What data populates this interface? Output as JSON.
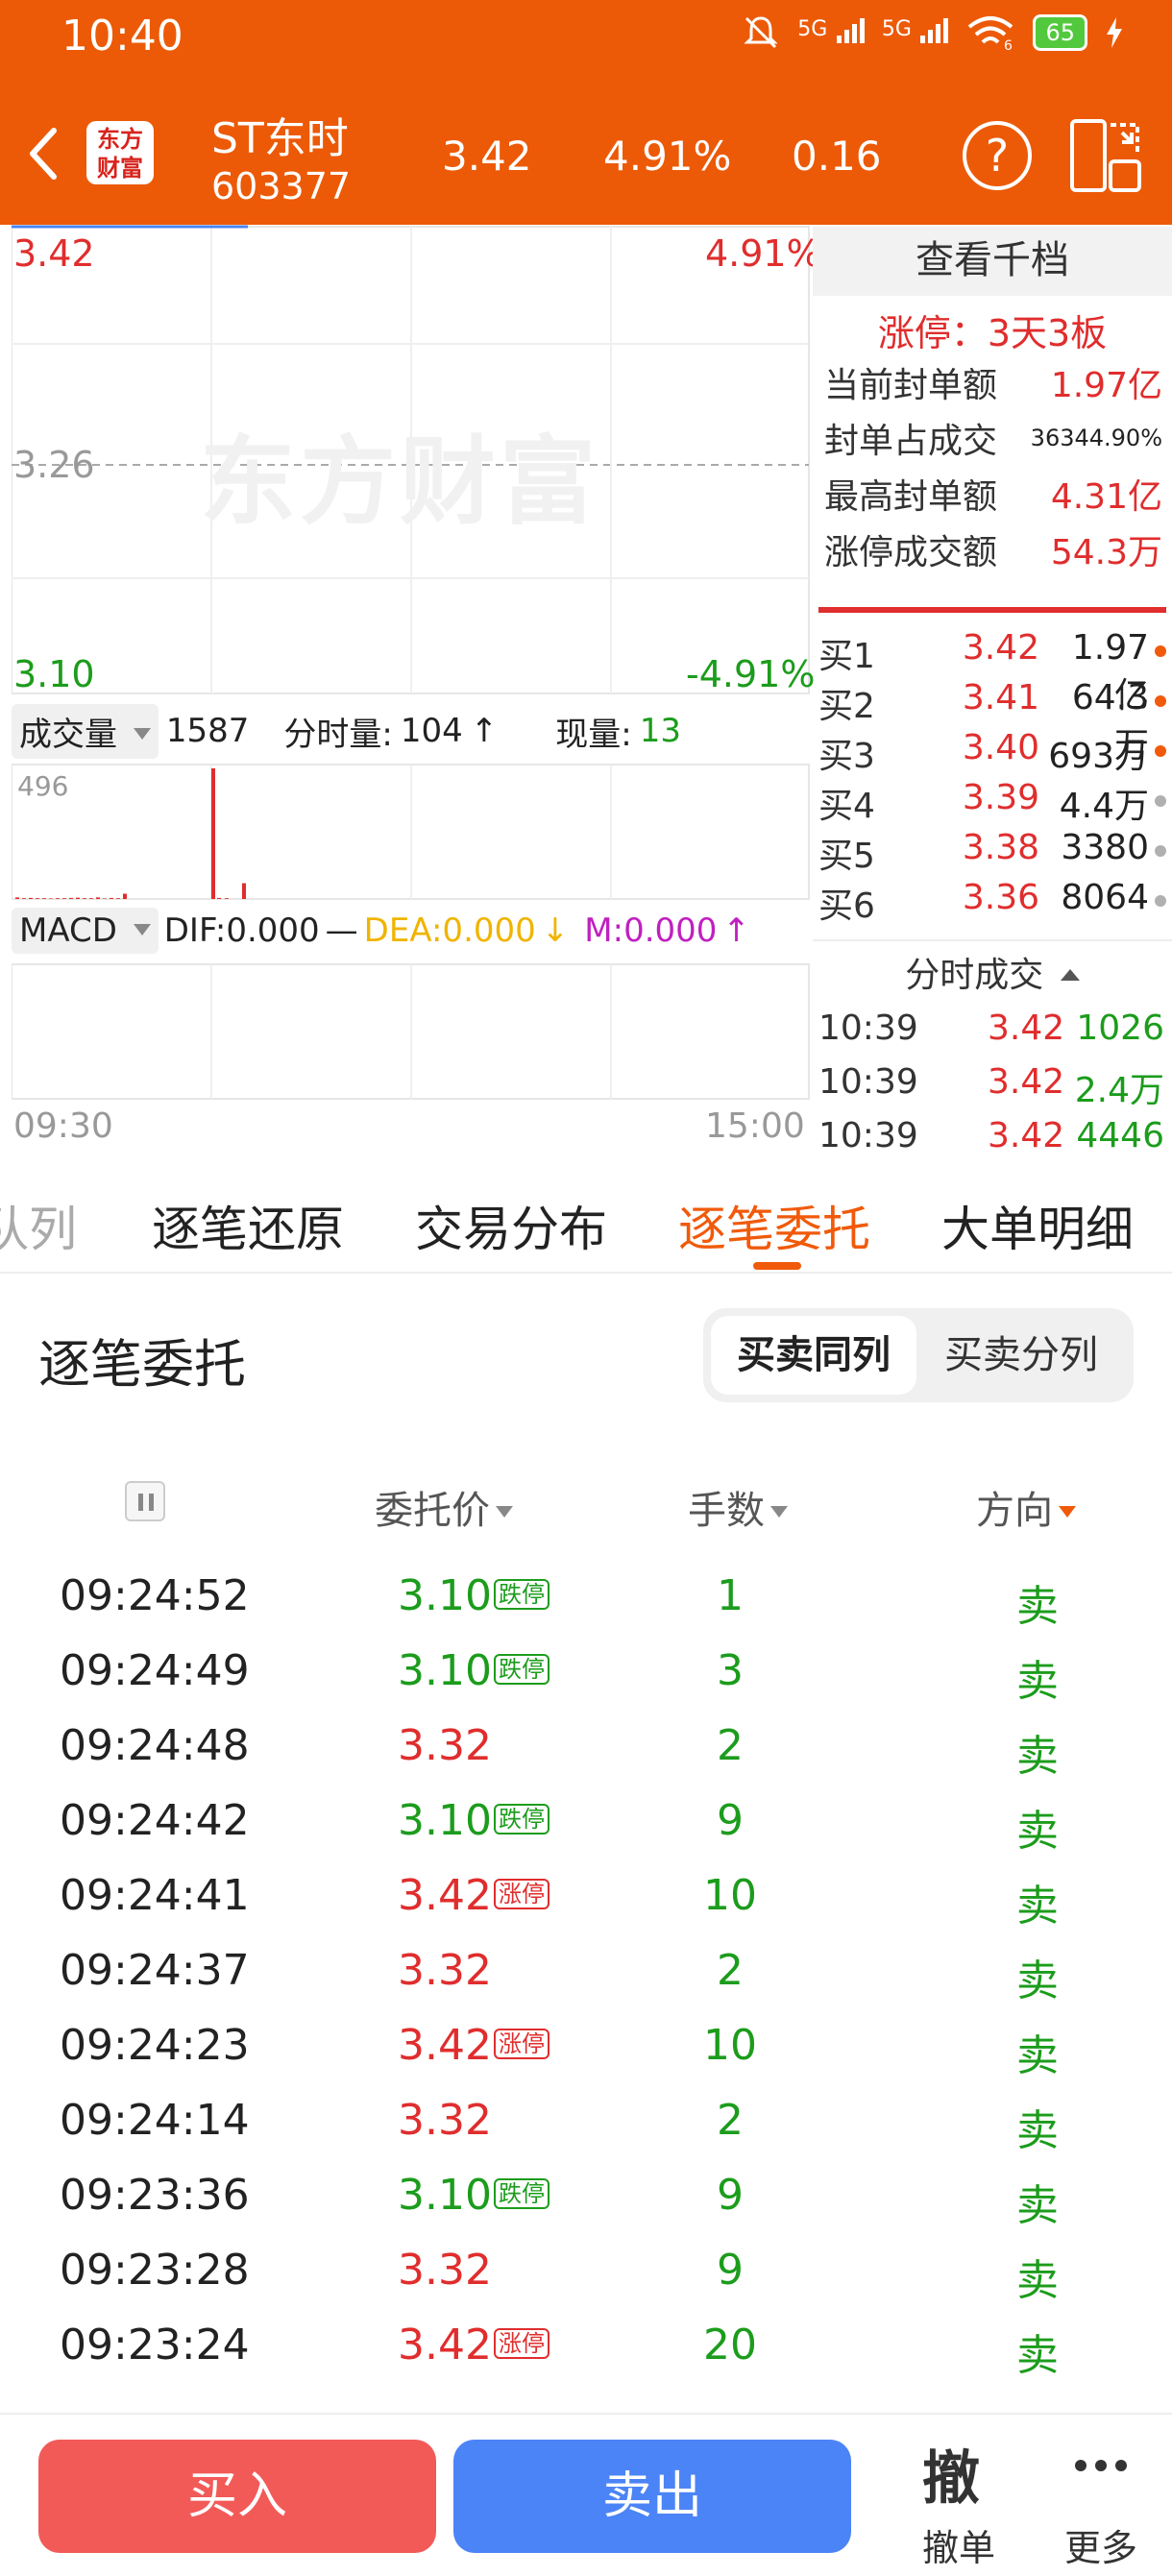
{
  "status": {
    "time": "10:40",
    "sig1": "5G",
    "sig2": "5G",
    "wifi_mark": "6",
    "battery": "65"
  },
  "header": {
    "logo_line1": "东方",
    "logo_line2": "财富",
    "name": "ST东时",
    "code": "603377",
    "price": "3.42",
    "pct": "4.91%",
    "change": "0.16"
  },
  "chart": {
    "top_left": "3.42",
    "top_right": "4.91%",
    "mid": "3.26",
    "bottom_left": "3.10",
    "bottom_right": "-4.91%",
    "watermark": "东方财富",
    "volume_select": "成交量",
    "volume_value": "1587",
    "minute_vol_label": "分时量:",
    "minute_vol_value": "104",
    "current_vol_label": "现量:",
    "current_vol_value": "13",
    "vol_axis_max": "496",
    "macd_select": "MACD",
    "dif": "DIF:0.000",
    "dea": "DEA:0.000",
    "m": "M:0.000",
    "time_start": "09:30",
    "time_end": "15:00",
    "volume_bars": [
      6,
      3,
      4,
      3,
      3,
      2,
      3,
      3,
      4,
      5,
      3,
      3,
      6,
      2,
      4,
      3,
      20,
      496,
      4,
      3,
      60
    ]
  },
  "right_panel": {
    "qiandang": "查看千档",
    "limit_title": "涨停：3天3板",
    "seal_rows": [
      {
        "label": "当前封单额",
        "value": "1.97亿"
      },
      {
        "label": "封单占成交",
        "value": "36344.90%"
      },
      {
        "label": "最高封单额",
        "value": "4.31亿"
      },
      {
        "label": "涨停成交额",
        "value": "54.3万"
      }
    ],
    "book": [
      {
        "label": "买1",
        "price": "3.42",
        "vol": "1.97亿",
        "dot": "#f05a0a"
      },
      {
        "label": "买2",
        "price": "3.41",
        "vol": "64.3万",
        "dot": "#f05a0a"
      },
      {
        "label": "买3",
        "price": "3.40",
        "vol": "693万",
        "dot": "#f05a0a"
      },
      {
        "label": "买4",
        "price": "3.39",
        "vol": "4.4万",
        "dot": "#b0b0b0"
      },
      {
        "label": "买5",
        "price": "3.38",
        "vol": "3380",
        "dot": "#b0b0b0"
      },
      {
        "label": "买6",
        "price": "3.36",
        "vol": "8064",
        "dot": "#b0b0b0"
      }
    ],
    "trades_title": "分时成交",
    "trades": [
      {
        "time": "10:39",
        "price": "3.42",
        "vol": "1026"
      },
      {
        "time": "10:39",
        "price": "3.42",
        "vol": "2.4万"
      },
      {
        "time": "10:39",
        "price": "3.42",
        "vol": "4446"
      }
    ]
  },
  "tabs": [
    {
      "label": "队列",
      "active": false
    },
    {
      "label": "逐笔还原",
      "active": false
    },
    {
      "label": "交易分布",
      "active": false
    },
    {
      "label": "逐笔委托",
      "active": true
    },
    {
      "label": "大单明细",
      "active": false
    }
  ],
  "section": {
    "title": "逐笔委托",
    "seg_active": "买卖同列",
    "seg_inactive": "买卖分列"
  },
  "columns": {
    "price": "委托价",
    "qty": "手数",
    "dir": "方向"
  },
  "orders": [
    {
      "time": "09:24:52",
      "price": "3.10",
      "tag": "跌停",
      "qty": "1",
      "dir": "卖"
    },
    {
      "time": "09:24:49",
      "price": "3.10",
      "tag": "跌停",
      "qty": "3",
      "dir": "卖"
    },
    {
      "time": "09:24:48",
      "price": "3.32",
      "tag": "",
      "qty": "2",
      "dir": "卖"
    },
    {
      "time": "09:24:42",
      "price": "3.10",
      "tag": "跌停",
      "qty": "9",
      "dir": "卖"
    },
    {
      "time": "09:24:41",
      "price": "3.42",
      "tag": "涨停",
      "qty": "10",
      "dir": "卖"
    },
    {
      "time": "09:24:37",
      "price": "3.32",
      "tag": "",
      "qty": "2",
      "dir": "卖"
    },
    {
      "time": "09:24:23",
      "price": "3.42",
      "tag": "涨停",
      "qty": "10",
      "dir": "卖"
    },
    {
      "time": "09:24:14",
      "price": "3.32",
      "tag": "",
      "qty": "2",
      "dir": "卖"
    },
    {
      "time": "09:23:36",
      "price": "3.10",
      "tag": "跌停",
      "qty": "9",
      "dir": "卖"
    },
    {
      "time": "09:23:28",
      "price": "3.32",
      "tag": "",
      "qty": "9",
      "dir": "卖"
    },
    {
      "time": "09:23:24",
      "price": "3.42",
      "tag": "涨停",
      "qty": "20",
      "dir": "卖"
    }
  ],
  "bottom": {
    "buy": "买入",
    "sell": "卖出",
    "cancel_big": "撤",
    "cancel_label": "撤单",
    "more_label": "更多"
  },
  "colors": {
    "brand": "#ec5a07",
    "up": "#e02d2d",
    "down": "#1c9c1c",
    "buy_button": "#f25a58",
    "sell_button": "#4b84f6",
    "dea": "#f0b400",
    "macd_m": "#c020c0"
  }
}
